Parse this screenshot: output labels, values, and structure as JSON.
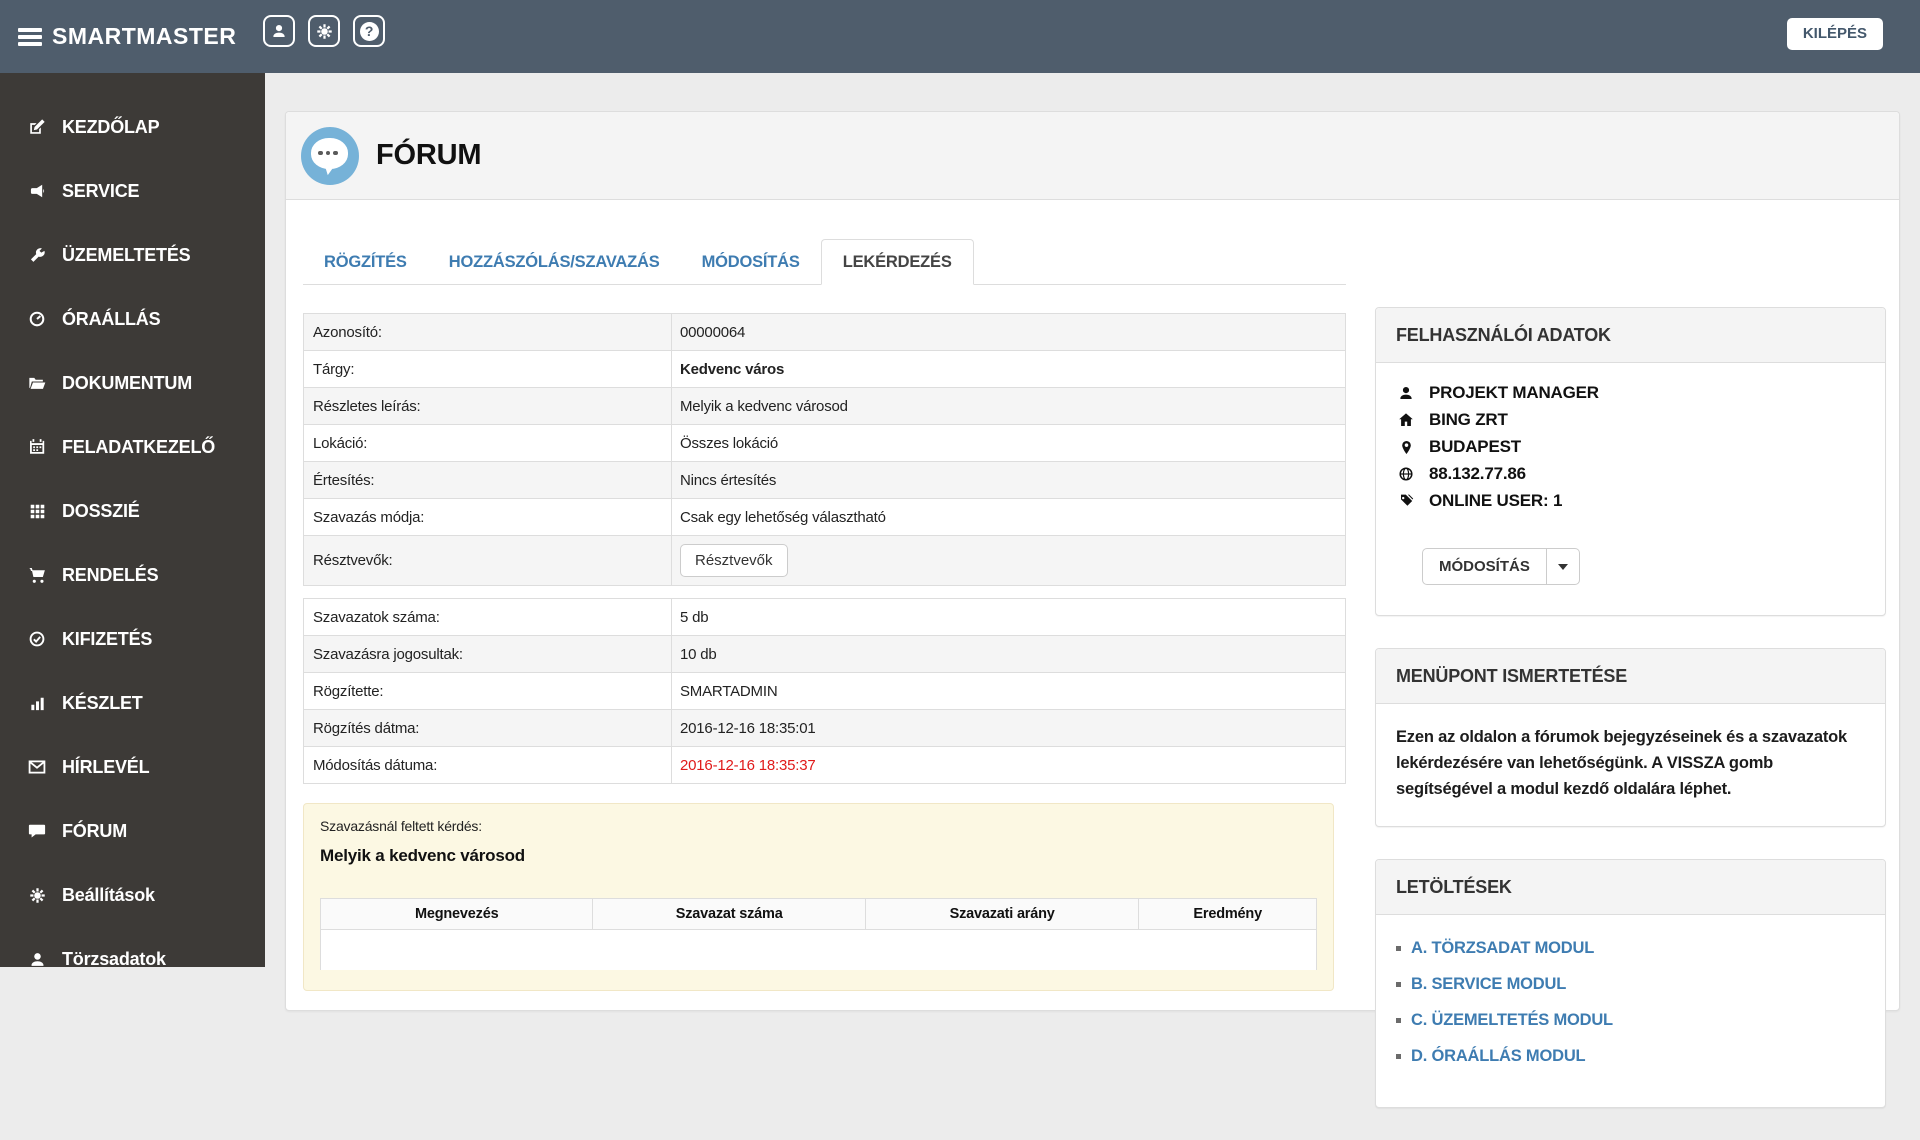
{
  "topbar": {
    "brand": "SMARTMASTER",
    "logout_label": "KILÉPÉS"
  },
  "sidebar": {
    "items": [
      {
        "icon": "edit-icon",
        "label": "KEZDŐLAP"
      },
      {
        "icon": "bullhorn-icon",
        "label": "SERVICE"
      },
      {
        "icon": "wrench-icon",
        "label": "ÜZEMELTETÉS"
      },
      {
        "icon": "gauge-icon",
        "label": "ÓRAÁLLÁS"
      },
      {
        "icon": "folder-icon",
        "label": "DOKUMENTUM"
      },
      {
        "icon": "calendar-icon",
        "label": "FELADATKEZELŐ"
      },
      {
        "icon": "grid-icon",
        "label": "DOSSZIÉ"
      },
      {
        "icon": "cart-icon",
        "label": "RENDELÉS"
      },
      {
        "icon": "check-circle-icon",
        "label": "KIFIZETÉS"
      },
      {
        "icon": "bar-chart-icon",
        "label": "KÉSZLET"
      },
      {
        "icon": "envelope-icon",
        "label": "HÍRLEVÉL"
      },
      {
        "icon": "comment-icon",
        "label": "FÓRUM"
      },
      {
        "icon": "gear-icon",
        "label": "Beállítások"
      },
      {
        "icon": "person-icon",
        "label": "Törzsadatok"
      }
    ]
  },
  "main": {
    "page_title": "FÓRUM",
    "tabs": [
      {
        "label": "RÖGZÍTÉS",
        "active": false
      },
      {
        "label": "HOZZÁSZÓLÁS/SZAVAZÁS",
        "active": false
      },
      {
        "label": "MÓDOSÍTÁS",
        "active": false
      },
      {
        "label": "LEKÉRDEZÉS",
        "active": true
      }
    ],
    "table1": {
      "rows": [
        {
          "label": "Azonosító:",
          "value": "00000064"
        },
        {
          "label": "Tárgy:",
          "value": "Kedvenc város"
        },
        {
          "label": "Részletes leírás:",
          "value": "Melyik a kedvenc városod"
        },
        {
          "label": "Lokáció:",
          "value": "Összes lokáció"
        },
        {
          "label": "Értesítés:",
          "value": "Nincs értesítés"
        },
        {
          "label": "Szavazás módja:",
          "value": "Csak egy lehetőség választható"
        },
        {
          "label": "Résztvevők:",
          "button": "Résztvevők"
        }
      ]
    },
    "table2": {
      "rows": [
        {
          "label": "Szavazatok száma:",
          "value": "5 db"
        },
        {
          "label": "Szavazásra jogosultak:",
          "value": "10 db"
        },
        {
          "label": "Rögzítette:",
          "value": "SMARTADMIN"
        },
        {
          "label": "Rögzítés dátma:",
          "value": "2016-12-16 18:35:01"
        },
        {
          "label": "Módosítás dátuma:",
          "value": "2016-12-16 18:35:37"
        }
      ]
    },
    "poll_panel": {
      "question_label": "Szavazásnál feltett kérdés:",
      "question": "Melyik a kedvenc városod",
      "headers": [
        "Megnevezés",
        "Szavazat száma",
        "Szavazati arány",
        "Eredmény"
      ]
    }
  },
  "right": {
    "user_panel": {
      "title": "FELHASZNÁLÓI ADATOK",
      "items": [
        {
          "icon": "person-icon",
          "text": "PROJEKT MANAGER"
        },
        {
          "icon": "home-icon",
          "text": "BING ZRT"
        },
        {
          "icon": "map-marker-icon",
          "text": "BUDAPEST"
        },
        {
          "icon": "globe-icon",
          "text": "88.132.77.86"
        },
        {
          "icon": "tags-icon",
          "text": "ONLINE USER: 1"
        }
      ],
      "modify_button": "MÓDOSÍTÁS"
    },
    "info_panel": {
      "title": "MENÜPONT ISMERTETÉSE",
      "text": "Ezen az oldalon a fórumok bejegyzéseinek és a szavazatok lekérdezésére van lehetőségünk. A VISSZA gomb segítségével a modul kezdő oldalára léphet."
    },
    "downloads_panel": {
      "title": "LETÖLTÉSEK",
      "links": [
        "A. TÖRZSADAT MODUL",
        "B. SERVICE MODUL",
        "C. ÜZEMELTETÉS MODUL",
        "D. ÓRAÁLLÁS MODUL"
      ]
    }
  },
  "colors": {
    "topbar": "#4f5d6c",
    "sidebar": "#3d3a37",
    "accent_blue": "#3e7cb1",
    "badge_blue": "#76b2d8",
    "danger_red": "#e01a1a",
    "poll_bg": "#fcf8e3"
  }
}
